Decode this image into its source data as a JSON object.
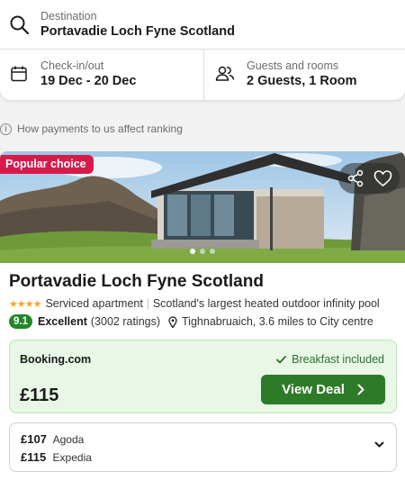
{
  "search": {
    "destination_label": "Destination",
    "destination_value": "Portavadie Loch Fyne Scotland",
    "dates_label": "Check-in/out",
    "dates_value": "19 Dec - 20 Dec",
    "guests_label": "Guests and rooms",
    "guests_value": "2 Guests, 1 Room"
  },
  "ranking_note": "How payments to us affect ranking",
  "hotel": {
    "badge": "Popular choice",
    "name": "Portavadie Loch Fyne Scotland",
    "star_count": 4,
    "stars_text": "★★★★",
    "type": "Serviced apartment",
    "tagline": "Scotland's largest heated outdoor infinity pool",
    "score": "9.1",
    "rating_word": "Excellent",
    "rating_count": "(3002 ratings)",
    "location": "Tighnabruaich, 3.6 miles to City centre",
    "photo_count_dots": 3,
    "active_photo": 1
  },
  "deal": {
    "provider": "Booking.com",
    "perk": "Breakfast included",
    "price": "£115",
    "button_label": "View Deal"
  },
  "alternatives": [
    {
      "price": "£107",
      "provider": "Agoda"
    },
    {
      "price": "£115",
      "provider": "Expedia"
    }
  ],
  "colors": {
    "badge": "#d61b4b",
    "accent_green": "#2d7a28",
    "deal_bg": "#e8f7e6",
    "stars": "#f5a623"
  },
  "icons": [
    "search-icon",
    "calendar-icon",
    "guests-icon",
    "info-icon",
    "share-icon",
    "heart-icon",
    "pin-icon",
    "check-icon",
    "chevron-right-icon",
    "chevron-down-icon"
  ]
}
